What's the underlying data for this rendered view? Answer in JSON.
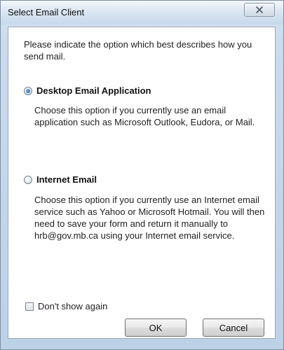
{
  "window": {
    "title": "Select Email Client"
  },
  "intro_text": "Please indicate the option which best describes how you send mail.",
  "options": [
    {
      "label": "Desktop Email Application",
      "selected": true,
      "description": "Choose this option if you currently use an email application such as Microsoft Outlook, Eudora, or Mail."
    },
    {
      "label": "Internet Email",
      "selected": false,
      "description": "Choose this option if you currently use an Internet email service such as Yahoo or Microsoft Hotmail. You will then need to save your form and return it manually to hrb@gov.mb.ca using your Internet email service."
    }
  ],
  "dont_show_again": {
    "label": "Don't show again",
    "checked": false
  },
  "buttons": {
    "ok": "OK",
    "cancel": "Cancel"
  }
}
